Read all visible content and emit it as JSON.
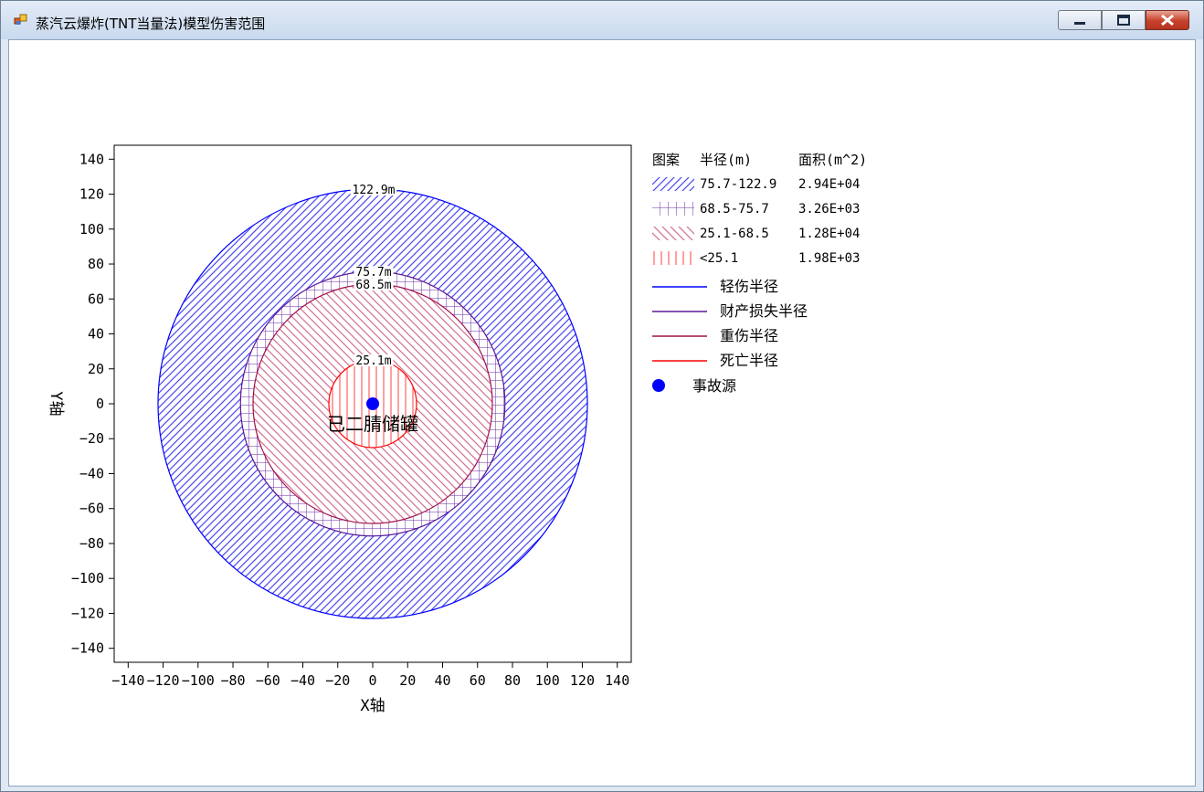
{
  "window": {
    "title": "蒸汽云爆炸(TNT当量法)模型伤害范围",
    "minimize_icon": "minimize-icon",
    "maximize_icon": "maximize-icon",
    "close_icon": "close-icon"
  },
  "chart_data": {
    "type": "scatter",
    "subtype": "concentric-damage-circles",
    "xlabel": "X轴",
    "ylabel": "Y轴",
    "xlim": [
      -148,
      148
    ],
    "ylim": [
      -148,
      148
    ],
    "xticks": [
      -140,
      -120,
      -100,
      -80,
      -60,
      -40,
      -20,
      0,
      20,
      40,
      60,
      80,
      100,
      120,
      140
    ],
    "yticks": [
      140,
      120,
      100,
      80,
      60,
      40,
      20,
      0,
      -20,
      -40,
      -60,
      -80,
      -100,
      -120,
      -140
    ],
    "source": {
      "x": 0,
      "y": 0,
      "label": "已二腈储罐",
      "color": "#0000ff"
    },
    "circles": [
      {
        "radius": 122.9,
        "label": "122.9m",
        "color": "#0000ff",
        "name": "轻伤半径"
      },
      {
        "radius": 75.7,
        "label": "75.7m",
        "color": "#5a189a",
        "name": "财产损失半径"
      },
      {
        "radius": 68.5,
        "label": "68.5m",
        "color": "#a0104a",
        "name": "重伤半径"
      },
      {
        "radius": 25.1,
        "label": "25.1m",
        "color": "#ff0000",
        "name": "死亡半径"
      }
    ],
    "legend": {
      "placement": "right",
      "headers": [
        "图案",
        "半径(m)",
        "面积(m^2)"
      ],
      "rows": [
        {
          "pattern": "forward-diagonal",
          "color": "#4a4af0",
          "range": "75.7-122.9",
          "area": "2.94E+04"
        },
        {
          "pattern": "grid",
          "color": "#6a2aa8",
          "range": "68.5-75.7",
          "area": "3.26E+03"
        },
        {
          "pattern": "back-diagonal",
          "color": "#c0407a",
          "range": "25.1-68.5",
          "area": "1.28E+04"
        },
        {
          "pattern": "vertical",
          "color": "#ff3030",
          "range": "<25.1",
          "area": "1.98E+03"
        }
      ],
      "lines": [
        {
          "label": "轻伤半径",
          "color": "#0000ff"
        },
        {
          "label": "财产损失半径",
          "color": "#5a189a"
        },
        {
          "label": "重伤半径",
          "color": "#a0104a"
        },
        {
          "label": "死亡半径",
          "color": "#ff0000"
        }
      ],
      "marker_label": "事故源"
    }
  }
}
